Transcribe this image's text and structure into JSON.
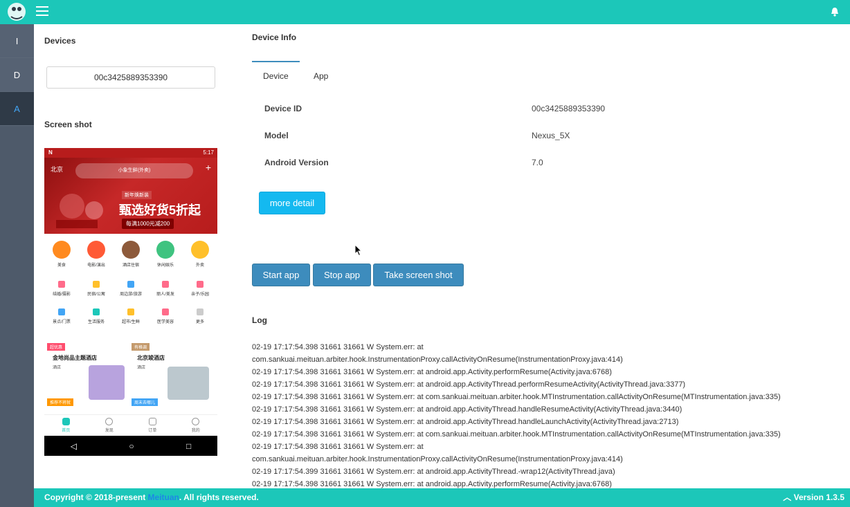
{
  "topbar": {
    "menu_icon": "hamburger-icon",
    "logo_icon": "app-logo-icon",
    "bell_icon": "bell-icon",
    "color": "#1cc7b9"
  },
  "sidebar": {
    "items": [
      {
        "label": "I"
      },
      {
        "label": "D"
      },
      {
        "label": "A",
        "active": true
      }
    ]
  },
  "devices": {
    "title": "Devices",
    "selected_device": "00c3425889353390",
    "screenshot_title": "Screen shot"
  },
  "phone": {
    "status_time": "5:17",
    "city": "北京",
    "search_placeholder": "小象生鲜(外卖)",
    "promo_tag": "新年焕新装",
    "promo_main": "甄选好货5折起",
    "promo_sub": "每满1000元减200",
    "row1": [
      "美食",
      "电影/演出",
      "酒店住宿",
      "休闲娱乐",
      "外卖"
    ],
    "row2": [
      "结婚/摄影",
      "民宿/公寓",
      "周边游/旅游",
      "丽人/美发",
      "亲子/乐园"
    ],
    "row3": [
      "景点/门票",
      "生活服务",
      "超市/生鲜",
      "医学美容",
      "更多"
    ],
    "cards": [
      {
        "tag": "超优惠",
        "title": "金地尚品主题酒店",
        "sub": "酒店"
      },
      {
        "tag": "有格调",
        "title": "北京竣酒店",
        "sub": "酒店"
      },
      {
        "tag": "推荐不将就",
        "title": "",
        "sub": ""
      },
      {
        "tag": "周末去哪儿",
        "title": "",
        "sub": ""
      }
    ],
    "tabs": [
      "首页",
      "发现",
      "订单",
      "我的"
    ]
  },
  "device_info": {
    "title": "Device Info",
    "tabs": [
      {
        "label": "Device",
        "active": true
      },
      {
        "label": "App"
      }
    ],
    "rows": [
      {
        "label": "Device ID",
        "value": "00c3425889353390"
      },
      {
        "label": "Model",
        "value": "Nexus_5X"
      },
      {
        "label": "Android Version",
        "value": "7.0"
      }
    ],
    "more_detail": "more detail"
  },
  "actions": {
    "start": "Start app",
    "stop": "Stop app",
    "screenshot": "Take screen shot"
  },
  "log": {
    "title": "Log",
    "lines": [
      "02-19 17:17:54.398 31661 31661 W System.err: at",
      "com.sankuai.meituan.arbiter.hook.InstrumentationProxy.callActivityOnResume(InstrumentationProxy.java:414)",
      "02-19 17:17:54.398 31661 31661 W System.err: at android.app.Activity.performResume(Activity.java:6768)",
      "02-19 17:17:54.398 31661 31661 W System.err: at android.app.ActivityThread.performResumeActivity(ActivityThread.java:3377)",
      "02-19 17:17:54.398 31661 31661 W System.err: at com.sankuai.meituan.arbiter.hook.MTInstrumentation.callActivityOnResume(MTInstrumentation.java:335)",
      "02-19 17:17:54.398 31661 31661 W System.err: at android.app.ActivityThread.handleResumeActivity(ActivityThread.java:3440)",
      "02-19 17:17:54.398 31661 31661 W System.err: at android.app.ActivityThread.handleLaunchActivity(ActivityThread.java:2713)",
      "02-19 17:17:54.398 31661 31661 W System.err: at com.sankuai.meituan.arbiter.hook.MTInstrumentation.callActivityOnResume(MTInstrumentation.java:335)",
      "02-19 17:17:54.398 31661 31661 W System.err: at",
      "com.sankuai.meituan.arbiter.hook.InstrumentationProxy.callActivityOnResume(InstrumentationProxy.java:414)",
      "02-19 17:17:54.399 31661 31661 W System.err: at android.app.ActivityThread.-wrap12(ActivityThread.java)",
      "02-19 17:17:54.398 31661 31661 W System.err: at android.app.Activity.performResume(Activity.java:6768)"
    ]
  },
  "footer": {
    "copyright_prefix": "Copyright © 2018-present ",
    "brand_link": "Meituan",
    "copyright_suffix": ". All rights reserved.",
    "version": "Version 1.3.5"
  }
}
